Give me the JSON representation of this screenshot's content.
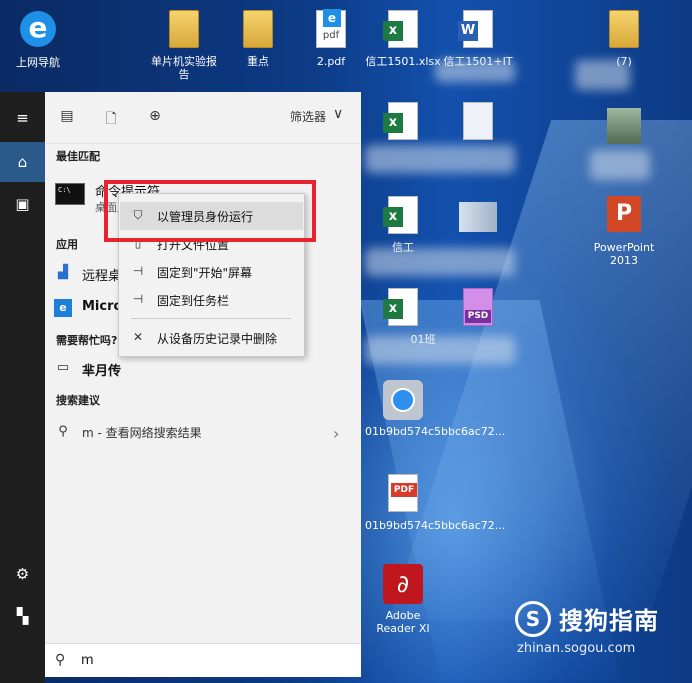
{
  "desktop": {
    "icons": [
      {
        "label": "上网导航",
        "kind": "ie"
      },
      {
        "label": "单片机实验报告",
        "kind": "folder"
      },
      {
        "label": "重点",
        "kind": "folder"
      },
      {
        "label": "2.pdf",
        "kind": "pdf"
      },
      {
        "label": "信工1501.xlsx",
        "kind": "excel"
      },
      {
        "label": "信工1501+IT",
        "kind": "word"
      },
      {
        "label": "PowerPoint 2013",
        "kind": "powerpoint"
      },
      {
        "label": "01b9bd574c5bbc6ac72...",
        "kind": "safari"
      },
      {
        "label": "01b9bd574c5bbc6ac72...",
        "kind": "pdf"
      },
      {
        "label": "Adobe Reader XI",
        "kind": "acrobat"
      }
    ],
    "partial_labels": {
      "xls_row3": "信工",
      "xls_row4_suffix": "01班",
      "psd": "PSD",
      "corner_folder": "(7)"
    }
  },
  "rail": {
    "items": [
      "menu-icon",
      "home-icon",
      "documents-icon",
      "settings-icon",
      "power-icon"
    ]
  },
  "start": {
    "filter_label": "筛选器",
    "best_match_header": "最佳匹配",
    "best_match": {
      "title": "命令提示符",
      "subtitle": "桌面应用"
    },
    "apps_header": "应用",
    "apps": [
      {
        "label": "远程桌面连接",
        "icon": "remote-desktop-icon"
      },
      {
        "label": "Microsoft Edge",
        "icon": "edge-icon"
      }
    ],
    "help_header": "需要帮忙吗?",
    "help_item": "芈月传",
    "suggest_header": "搜索建议",
    "suggest_item": "m - 查看网络搜索结果",
    "search_query": "m"
  },
  "context_menu": {
    "items": [
      {
        "label": "以管理员身份运行",
        "icon": "shield-icon",
        "highlighted": true
      },
      {
        "label": "打开文件位置",
        "icon": "folder-icon"
      },
      {
        "label": "固定到\"开始\"屏幕",
        "icon": "pin-icon"
      },
      {
        "label": "固定到任务栏",
        "icon": "pin-icon"
      },
      {
        "label": "从设备历史记录中删除",
        "icon": "close-icon"
      }
    ]
  },
  "watermark": {
    "brand": "搜狗指南",
    "url": "zhinan.sogou.com",
    "logo_letter": "S"
  },
  "colors": {
    "highlight_box": "#e8232e",
    "rail_active": "#2a5a8a"
  }
}
